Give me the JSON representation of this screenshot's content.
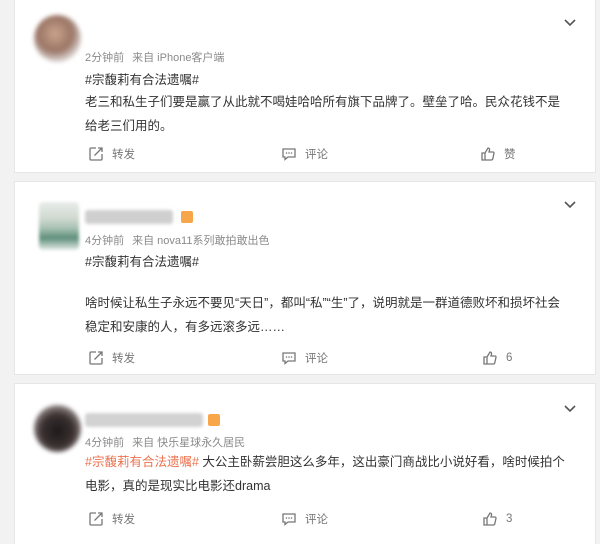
{
  "comments": [
    {
      "time": "2分钟前",
      "source": "来自 iPhone客户端",
      "topic": "#宗馥莉有合法遗嘱#",
      "text_lines": [
        "老三和私生子们要是赢了从此就不喝娃哈哈所有旗下品牌了。壁垒了哈。民众花钱不是",
        "给老三们用的。"
      ],
      "repost_label": "转发",
      "comment_label": "评论",
      "like_label": "赞"
    },
    {
      "time": "4分钟前",
      "source": "来自 nova11系列敢拍敢出色",
      "topic": "#宗馥莉有合法遗嘱#",
      "text_lines": [
        "啥时候让私生子永远不要见“天日”，都叫“私”“生”了，说明就是一群道德败坏和损坏社会",
        "稳定和安康的人，有多远滚多远……"
      ],
      "repost_label": "转发",
      "comment_label": "评论",
      "like_label": "6"
    },
    {
      "time": "4分钟前",
      "source": "来自 快乐星球永久居民",
      "topic": "#宗馥莉有合法遗嘱#",
      "text_first": " 大公主卧薪尝胆这么多年，这出豪门商战比小说好看，啥时候拍个",
      "text_second": "电影，真的是现实比电影还drama",
      "repost_label": "转发",
      "comment_label": "评论",
      "like_label": "3"
    }
  ],
  "colors": {
    "topic": "#eb7350",
    "text": "#333333",
    "meta": "#8a8a8a",
    "badge": "#f7a64a"
  }
}
